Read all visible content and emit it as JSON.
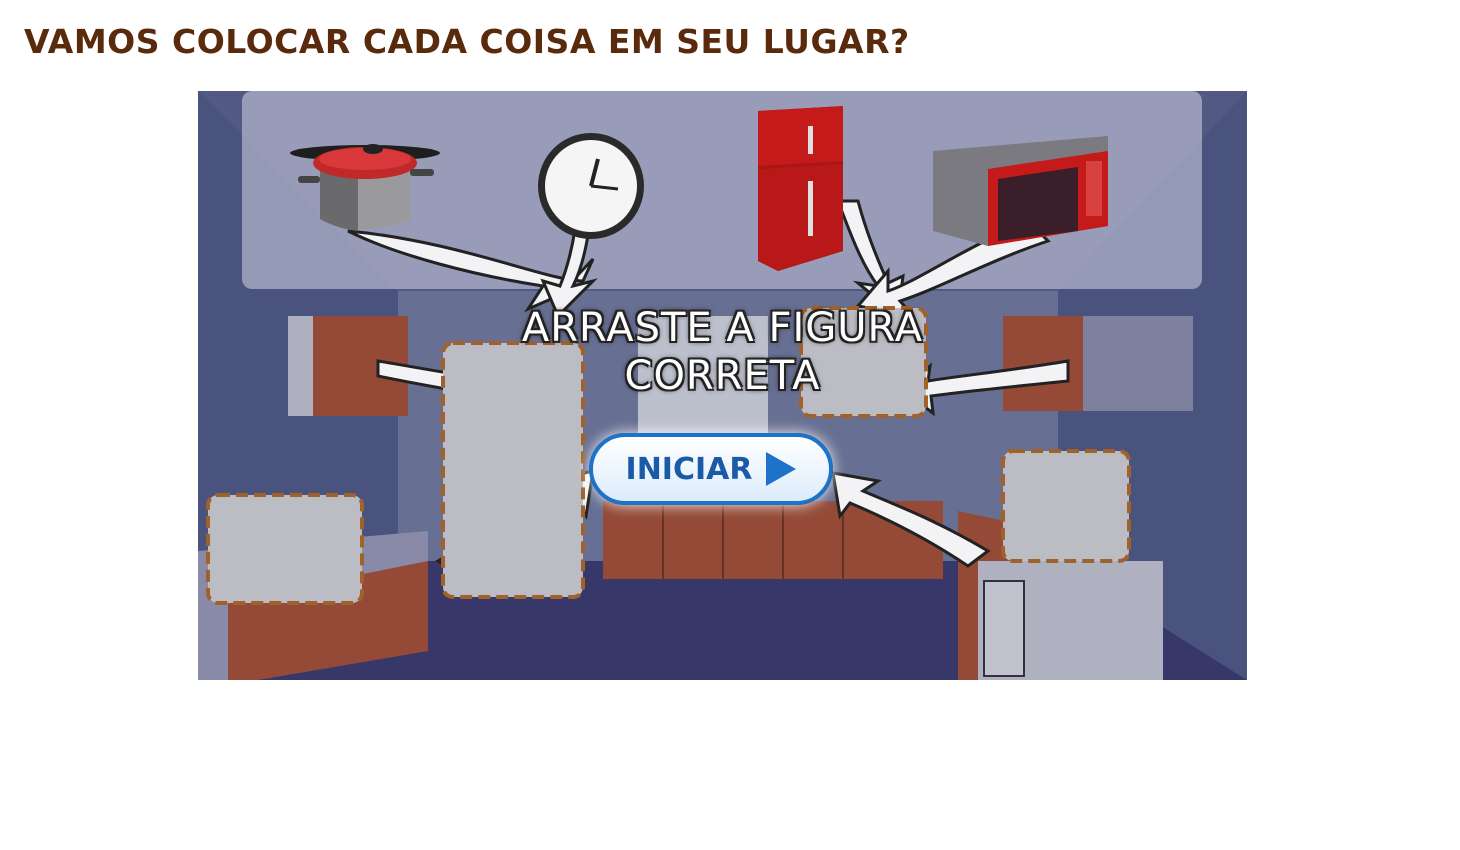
{
  "page": {
    "title": "VAMOS COLOCAR CADA COISA EM SEU LUGAR?"
  },
  "game": {
    "instruction": "ARRASTE A FIGURA CORRETA",
    "start_button": {
      "label": "INICIAR",
      "icon": "play-icon"
    },
    "draggable_items": [
      {
        "name": "panela",
        "icon": "pot-icon"
      },
      {
        "name": "relógio",
        "icon": "clock-icon"
      },
      {
        "name": "geladeira",
        "icon": "refrigerator-icon"
      },
      {
        "name": "micro-ondas",
        "icon": "microwave-icon"
      }
    ],
    "drop_zones_count": 5,
    "colors": {
      "title": "#5a2a0c",
      "drop_zone_border": "#a0622a",
      "button_border": "#1d73c7",
      "button_text": "#1a5aa6",
      "cabinet": "#b8552f",
      "refrigerator": "#c41a1a"
    }
  }
}
